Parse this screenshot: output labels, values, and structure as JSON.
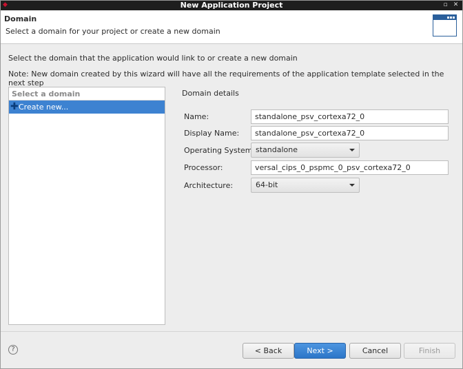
{
  "window": {
    "title": "New Application Project",
    "app_icon": "xilinx-logo-icon",
    "controls": [
      "restore-icon",
      "close-icon"
    ]
  },
  "header": {
    "title": "Domain",
    "description": "Select a domain for your project or create a new domain",
    "icon": "wizard-banner-icon"
  },
  "intro": {
    "line1": "Select the domain that the application would link to or create a new domain",
    "line2": "Note: New domain created by this wizard will have all the requirements of the application template selected in the next step"
  },
  "domain_list": {
    "header": "Select a domain",
    "items": [
      {
        "label": "Create new...",
        "selected": true,
        "icon": "plus-icon"
      }
    ]
  },
  "details": {
    "title": "Domain details",
    "name_label": "Name:",
    "name_value": "standalone_psv_cortexa72_0",
    "display_name_label": "Display Name:",
    "display_name_value": "standalone_psv_cortexa72_0",
    "os_label": "Operating System:",
    "os_value": "standalone",
    "processor_label": "Processor:",
    "processor_value": "versal_cips_0_pspmc_0_psv_cortexa72_0",
    "arch_label": "Architecture:",
    "arch_value": "64-bit"
  },
  "footer": {
    "help_icon": "help-icon",
    "back_label": "< Back",
    "next_label": "Next >",
    "cancel_label": "Cancel",
    "finish_label": "Finish"
  },
  "colors": {
    "accent": "#3d82d1",
    "titlebar": "#1e1e1e",
    "primary_button": "#2c76c8"
  }
}
